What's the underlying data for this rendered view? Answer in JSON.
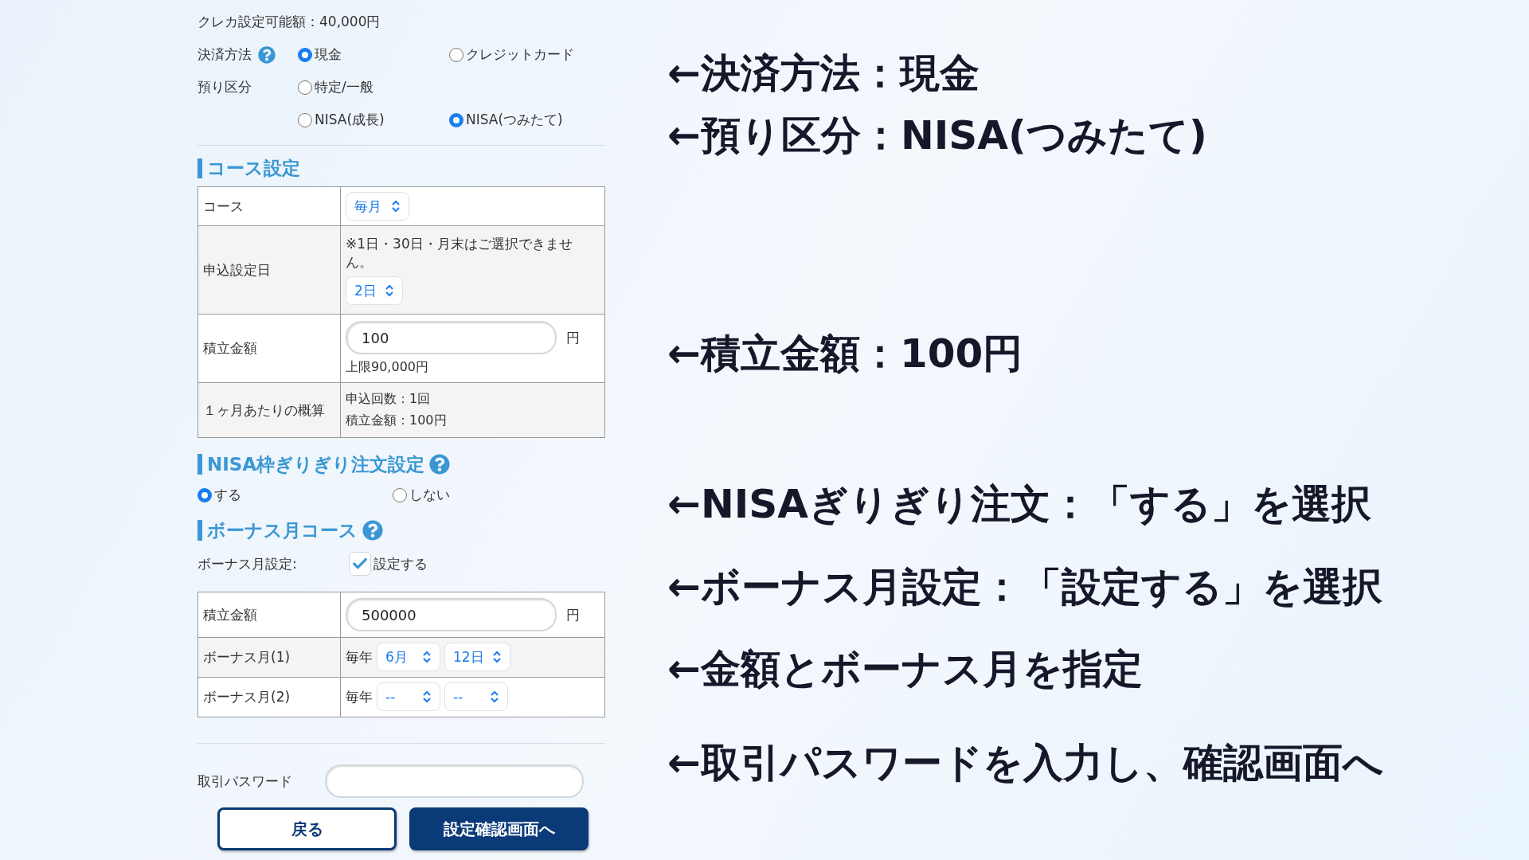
{
  "credit_limit": "クレカ設定可能額：40,000円",
  "payment_method": {
    "label": "決済方法",
    "options": [
      {
        "label": "現金",
        "selected": true
      },
      {
        "label": "クレジットカード",
        "selected": false
      }
    ]
  },
  "deposit_type": {
    "label": "預り区分",
    "options": [
      {
        "label": "特定/一般",
        "selected": false
      },
      {
        "label": "NISA(成長)",
        "selected": false
      },
      {
        "label": "NISA(つみたて)",
        "selected": true
      }
    ]
  },
  "course_section": {
    "title": "コース設定",
    "rows": [
      {
        "kind": "select",
        "label": "コース",
        "select": "毎月"
      },
      {
        "kind": "date",
        "label": "申込設定日",
        "note": "※1日・30日・月末はご選択できません。",
        "select": "2日"
      },
      {
        "kind": "amount",
        "label": "積立金額",
        "value": "100",
        "unit": "円",
        "limit": "上限90,000円"
      },
      {
        "kind": "summary",
        "label": "１ヶ月あたりの概算",
        "lines": [
          "申込回数：1回",
          "積立金額：100円"
        ]
      }
    ]
  },
  "nisa_section": {
    "title": "NISA枠ぎりぎり注文設定",
    "options": [
      {
        "label": "する",
        "selected": true
      },
      {
        "label": "しない",
        "selected": false
      }
    ]
  },
  "bonus_section": {
    "title": "ボーナス月コース",
    "setting_label": "ボーナス月設定:",
    "checkbox": {
      "label": "設定する",
      "checked": true
    },
    "rows": [
      {
        "kind": "amount",
        "label": "積立金額",
        "value": "500000",
        "unit": "円"
      },
      {
        "kind": "months",
        "label": "ボーナス月(1)",
        "prefix": "毎年",
        "selects": [
          "6月",
          "12日"
        ]
      },
      {
        "kind": "months",
        "label": "ボーナス月(2)",
        "prefix": "毎年",
        "selects": [
          "--",
          "--"
        ]
      }
    ]
  },
  "password": {
    "label": "取引パスワード"
  },
  "buttons": [
    {
      "kind": "secondary",
      "label": "戻る"
    },
    {
      "kind": "primary",
      "label": "設定確認画面へ"
    }
  ],
  "annotations": [
    "←決済方法：現金",
    "←預り区分：NISA(つみたて)",
    "←積立金額：100円",
    "←NISAぎりぎり注文：「する」を選択",
    "←ボーナス月設定：「設定する」を選択",
    "←金額とボーナス月を指定",
    "←取引パスワードを入力し、確認画面へ"
  ]
}
